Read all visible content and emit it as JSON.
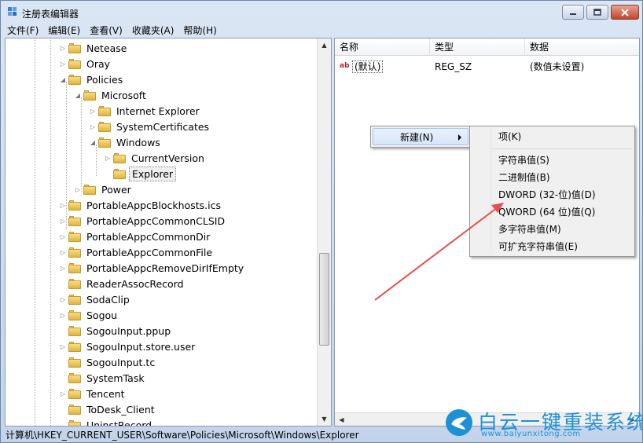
{
  "window": {
    "title": "注册表编辑器",
    "controls": {
      "minimize": "minimize",
      "maximize": "maximize",
      "close": "close"
    }
  },
  "menubar": [
    {
      "label": "文件(F)"
    },
    {
      "label": "编辑(E)"
    },
    {
      "label": "查看(V)"
    },
    {
      "label": "收藏夹(A)"
    },
    {
      "label": "帮助(H)"
    }
  ],
  "tree": {
    "items": [
      {
        "label": "Netease",
        "expander": "▷"
      },
      {
        "label": "Oray",
        "expander": "▷"
      },
      {
        "label": "Policies",
        "expander": "◢"
      },
      {
        "label": "Microsoft",
        "expander": "◢"
      },
      {
        "label": "Internet Explorer",
        "expander": "▷"
      },
      {
        "label": "SystemCertificates",
        "expander": "▷"
      },
      {
        "label": "Windows",
        "expander": "◢"
      },
      {
        "label": "CurrentVersion",
        "expander": "▷"
      },
      {
        "label": "Explorer",
        "expander": "",
        "selected": true
      },
      {
        "label": "Power",
        "expander": "▷"
      },
      {
        "label": "PortableAppcBlockhosts.ics",
        "expander": "▷"
      },
      {
        "label": "PortableAppcCommonCLSID",
        "expander": "▷"
      },
      {
        "label": "PortableAppcCommonDir",
        "expander": "▷"
      },
      {
        "label": "PortableAppcCommonFile",
        "expander": "▷"
      },
      {
        "label": "PortableAppcRemoveDirIfEmpty",
        "expander": "▷"
      },
      {
        "label": "ReaderAssocRecord",
        "expander": ""
      },
      {
        "label": "SodaClip",
        "expander": "▷"
      },
      {
        "label": "Sogou",
        "expander": "▷"
      },
      {
        "label": "SogouInput.ppup",
        "expander": ""
      },
      {
        "label": "SogouInput.store.user",
        "expander": "▷"
      },
      {
        "label": "SogouInput.tc",
        "expander": ""
      },
      {
        "label": "SystemTask",
        "expander": ""
      },
      {
        "label": "Tencent",
        "expander": "▷"
      },
      {
        "label": "ToDesk_Client",
        "expander": ""
      },
      {
        "label": "UninstRecord",
        "expander": ""
      }
    ]
  },
  "list": {
    "columns": [
      "名称",
      "类型",
      "数据"
    ],
    "rows": [
      {
        "icon": "ab",
        "name": "(默认)",
        "type": "REG_SZ",
        "data": "(数值未设置)"
      }
    ]
  },
  "context_menu": {
    "new_item": "新建(N)"
  },
  "submenu": {
    "items": [
      {
        "label": "项(K)"
      },
      {
        "label": "字符串值(S)"
      },
      {
        "label": "二进制值(B)"
      },
      {
        "label": "DWORD (32-位)值(D)"
      },
      {
        "label": "QWORD (64 位)值(Q)"
      },
      {
        "label": "多字符串值(M)"
      },
      {
        "label": "可扩充字符串值(E)"
      }
    ]
  },
  "statusbar": {
    "path": "计算机\\HKEY_CURRENT_USER\\Software\\Policies\\Microsoft\\Windows\\Explorer"
  },
  "watermark": {
    "title": "白云一键重装系统",
    "url": "www.baiyunxitong.com"
  },
  "colors": {
    "annotation_arrow": "#e84c4c",
    "watermark": "#1e90d6",
    "folder": "#e9c45a"
  }
}
